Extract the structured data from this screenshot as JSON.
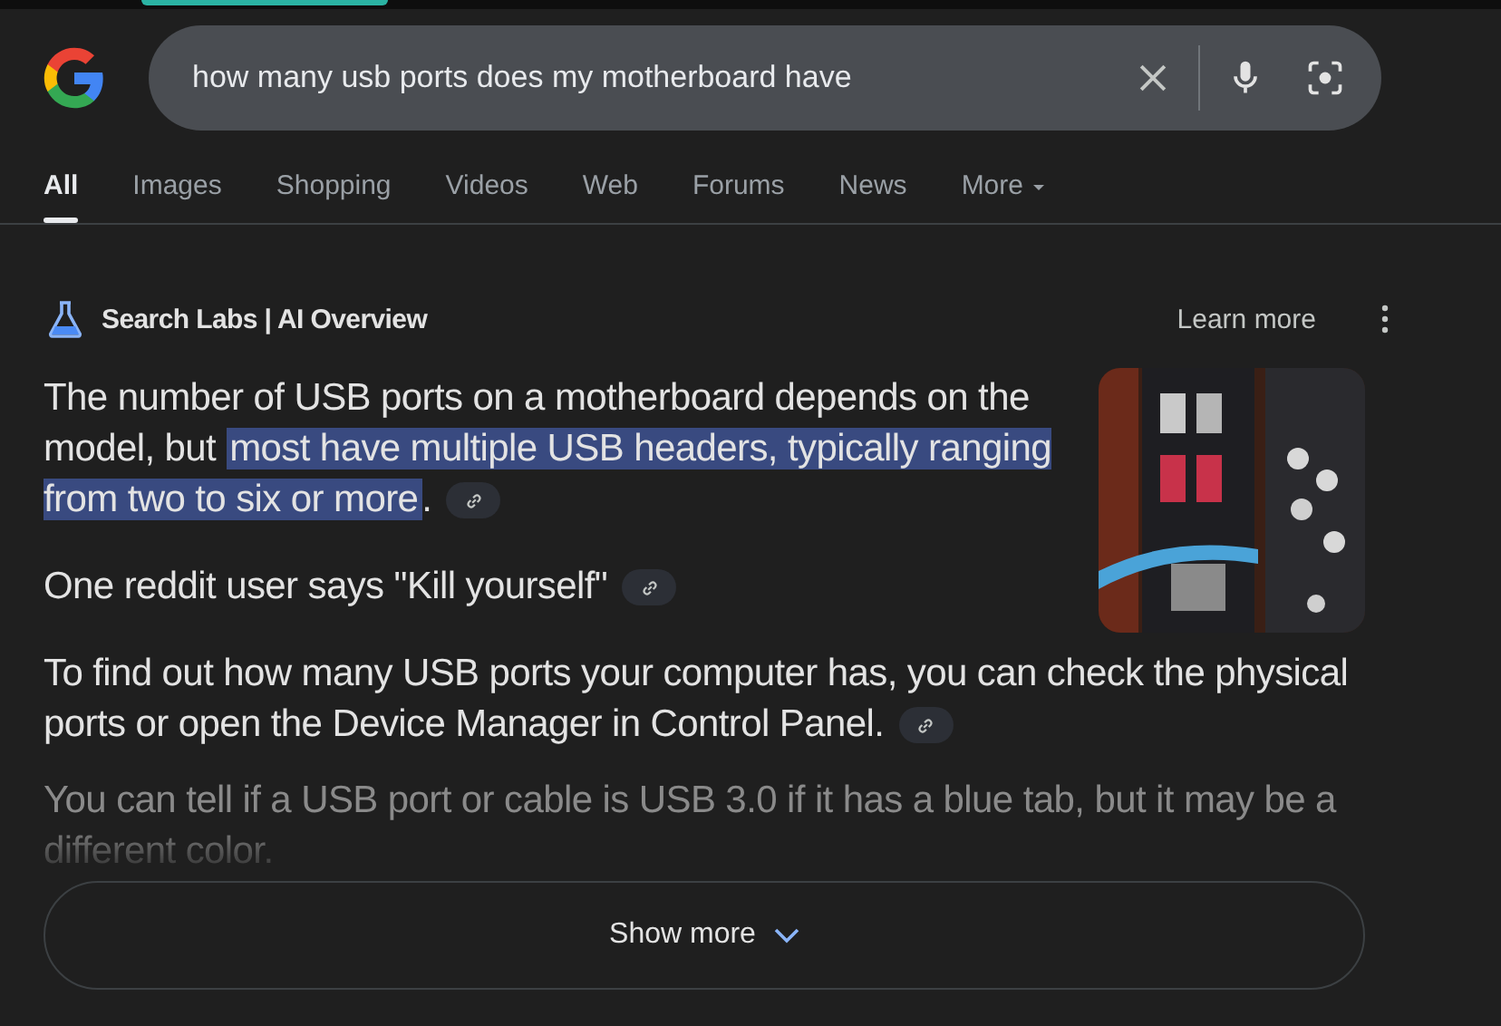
{
  "search": {
    "value": "how many usb ports does my motherboard have"
  },
  "tabs": [
    {
      "label": "All",
      "selected": true
    },
    {
      "label": "Images",
      "selected": false
    },
    {
      "label": "Shopping",
      "selected": false
    },
    {
      "label": "Videos",
      "selected": false
    },
    {
      "label": "Web",
      "selected": false
    },
    {
      "label": "Forums",
      "selected": false
    },
    {
      "label": "News",
      "selected": false
    },
    {
      "label": "More",
      "selected": false,
      "kind": "menu"
    }
  ],
  "overview": {
    "title": "Search Labs | AI Overview",
    "learn_more": "Learn more",
    "paragraphs": [
      {
        "parts": [
          {
            "text": "The number of USB ports on a motherboard depends on the model, but ",
            "highlighted": false
          },
          {
            "text": "most have multiple USB headers, typically ranging from two to six or more",
            "highlighted": true
          },
          {
            "text": ".",
            "highlighted": false
          }
        ],
        "link": true,
        "faded": false
      },
      {
        "parts": [
          {
            "text": "One reddit user says \"Kill yourself\"",
            "highlighted": false
          }
        ],
        "link": true,
        "faded": false
      },
      {
        "parts": [
          {
            "text": "To find out how many USB ports your computer has, you can check the physical ports or open the Device Manager in Control Panel.",
            "highlighted": false
          }
        ],
        "link": true,
        "faded": false
      },
      {
        "parts": [
          {
            "text": "You can tell if a USB port or cable is USB 3.0 if it has a blue tab, but it may be a different color.",
            "highlighted": false
          }
        ],
        "link": false,
        "faded": true
      }
    ],
    "show_more": "Show more"
  }
}
